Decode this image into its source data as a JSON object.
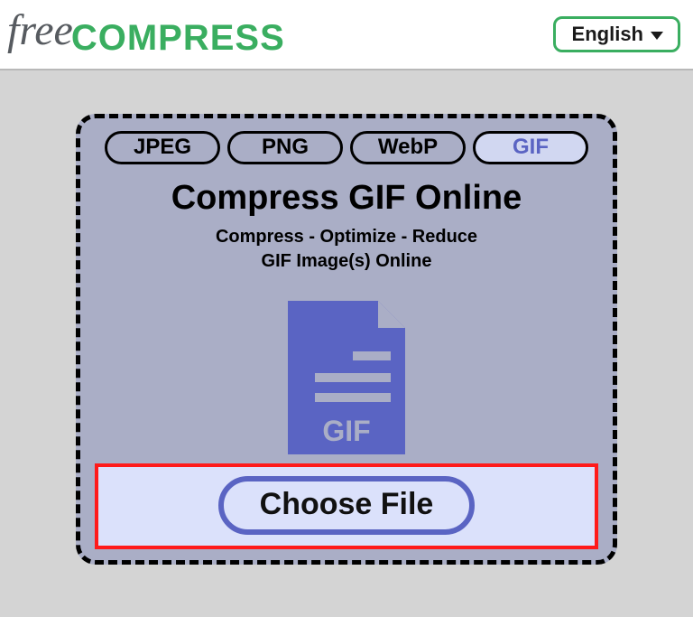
{
  "header": {
    "logo_free": "free",
    "logo_compress": "COMPRESS",
    "language_label": "English"
  },
  "tabs": [
    {
      "label": "JPEG",
      "active": false
    },
    {
      "label": "PNG",
      "active": false
    },
    {
      "label": "WebP",
      "active": false
    },
    {
      "label": "GIF",
      "active": true
    }
  ],
  "main": {
    "title": "Compress GIF Online",
    "subtitle_line1": "Compress - Optimize - Reduce",
    "subtitle_line2": "GIF Image(s) Online",
    "file_badge": "GIF",
    "choose_label": "Choose File"
  },
  "colors": {
    "brand_green": "#3aae60",
    "panel_bg": "#aaaec6",
    "accent_blue": "#5a64c3",
    "highlight_red": "#ff1a1a"
  }
}
